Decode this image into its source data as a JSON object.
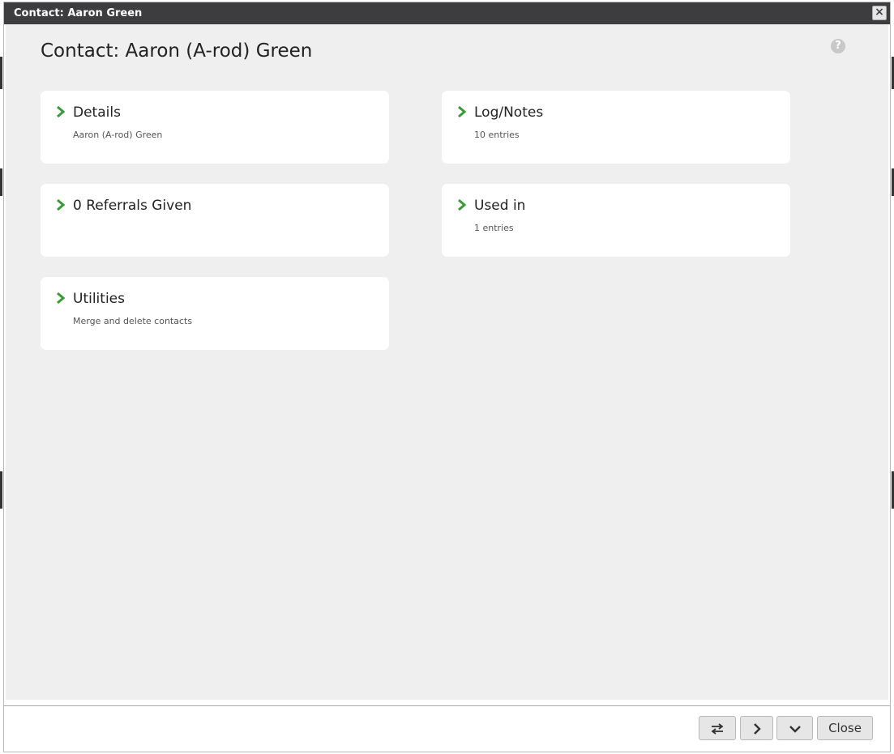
{
  "window": {
    "title": "Contact: Aaron Green"
  },
  "page": {
    "heading": "Contact: Aaron (A-rod) Green",
    "help_glyph": "?"
  },
  "cards": [
    {
      "title": "Details",
      "subtitle": "Aaron (A-rod) Green"
    },
    {
      "title": "Log/Notes",
      "subtitle": "10 entries"
    },
    {
      "title": "0 Referrals Given",
      "subtitle": ""
    },
    {
      "title": "Used in",
      "subtitle": "1 entries"
    },
    {
      "title": "Utilities",
      "subtitle": "Merge and delete contacts"
    }
  ],
  "footer": {
    "close_label": "Close"
  },
  "icons": {
    "card_chevron": "chevron-right-icon",
    "swap": "swap-arrows-icon",
    "next": "chevron-right-icon",
    "expand": "chevron-down-icon",
    "window_close": "close-icon",
    "help": "help-icon"
  },
  "colors": {
    "accent_green": "#3a9a3a",
    "titlebar": "#3d3d40",
    "content_bg": "#efefef"
  }
}
